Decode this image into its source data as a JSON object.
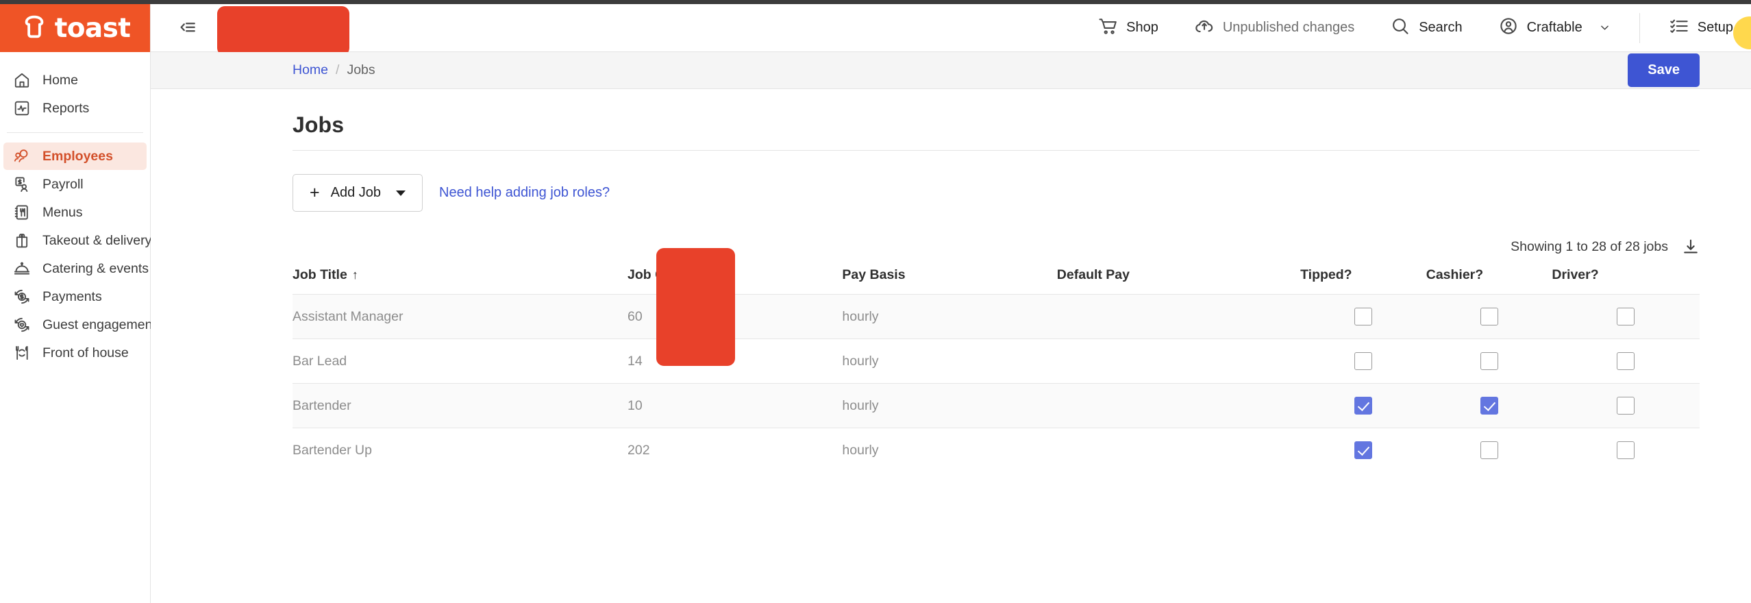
{
  "brand": {
    "name": "toast",
    "logo_icon": "toast-bread-icon"
  },
  "sidebar": {
    "groups": [
      {
        "items": [
          {
            "label": "Home",
            "icon": "home-icon",
            "active": false
          },
          {
            "label": "Reports",
            "icon": "reports-chart-icon",
            "active": false
          }
        ]
      },
      {
        "items": [
          {
            "label": "Employees",
            "icon": "employees-people-icon",
            "active": true
          },
          {
            "label": "Payroll",
            "icon": "payroll-dollar-person-icon",
            "active": false
          },
          {
            "label": "Menus",
            "icon": "menus-book-utensils-icon",
            "active": false
          },
          {
            "label": "Takeout & delivery",
            "icon": "takeout-bag-icon",
            "active": false
          },
          {
            "label": "Catering & events",
            "icon": "catering-bell-icon",
            "active": false
          },
          {
            "label": "Payments",
            "icon": "payments-dollar-refresh-icon",
            "active": false
          },
          {
            "label": "Guest engagement",
            "icon": "guest-heart-refresh-icon",
            "active": false
          },
          {
            "label": "Front of house",
            "icon": "front-of-house-plate-utensils-icon",
            "active": false
          }
        ]
      }
    ]
  },
  "topbar": {
    "collapse_icon": "collapse-sidebar-icon",
    "links": [
      {
        "label": "Shop",
        "icon": "shopping-cart-icon",
        "muted": false
      },
      {
        "label": "Unpublished changes",
        "icon": "cloud-upload-icon",
        "muted": true
      },
      {
        "label": "Search",
        "icon": "search-icon",
        "muted": false
      },
      {
        "label": "Craftable",
        "icon": "user-circle-icon",
        "muted": false,
        "has_caret": true
      }
    ],
    "setup": {
      "label": "Setup",
      "icon": "checklist-icon"
    }
  },
  "breadcrumb": {
    "home_label": "Home",
    "separator": "/",
    "current_label": "Jobs"
  },
  "save": {
    "label": "Save",
    "color": "#3e55d3"
  },
  "page": {
    "title": "Jobs",
    "add_job_label": "Add Job",
    "add_job_plus": "+",
    "help_link": "Need help adding job roles?",
    "showing_text": "Showing 1 to 28 of 28 jobs",
    "download_icon": "download-icon"
  },
  "table": {
    "columns": [
      {
        "label": "Job Title",
        "sort": "↑"
      },
      {
        "label": "Job Code"
      },
      {
        "label": "Pay Basis"
      },
      {
        "label": "Default Pay"
      },
      {
        "label": "Tipped?"
      },
      {
        "label": "Cashier?"
      },
      {
        "label": "Driver?"
      }
    ],
    "rows": [
      {
        "title": "Assistant Manager",
        "code": "60",
        "basis": "hourly",
        "pay": "",
        "tipped": false,
        "cashier": false,
        "driver": false
      },
      {
        "title": "Bar Lead",
        "code": "14",
        "basis": "hourly",
        "pay": "",
        "tipped": false,
        "cashier": false,
        "driver": false
      },
      {
        "title": "Bartender",
        "code": "10",
        "basis": "hourly",
        "pay": "",
        "tipped": true,
        "cashier": true,
        "driver": false
      },
      {
        "title": "Bartender Up",
        "code": "202",
        "basis": "hourly",
        "pay": "",
        "tipped": true,
        "cashier": false,
        "driver": false
      }
    ]
  },
  "colors": {
    "brand_orange": "#ef5426",
    "active_orange": "#d3502a",
    "active_bg": "#fbe7e0",
    "link_blue": "#3e55d3",
    "checkbox_blue": "#6376e0",
    "redaction_red": "#e8412a"
  }
}
